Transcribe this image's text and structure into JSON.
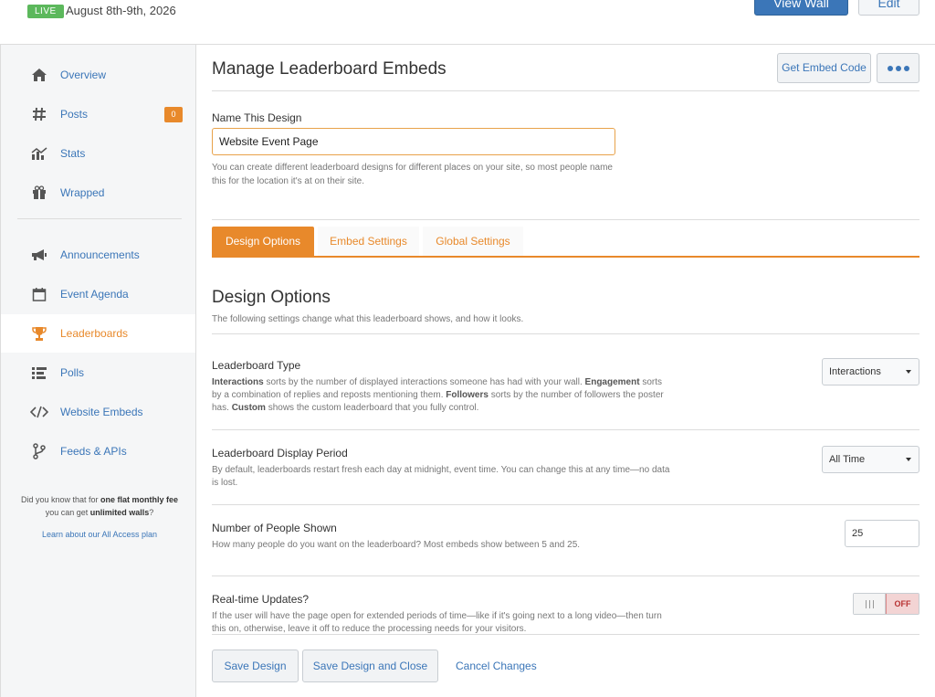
{
  "header": {
    "live_badge": "LIVE",
    "event_date": "August 8th-9th, 2026",
    "view_wall_label": "View Wall",
    "edit_label": "Edit"
  },
  "sidebar": {
    "items": [
      {
        "label": "Overview",
        "icon": "home-icon"
      },
      {
        "label": "Posts",
        "icon": "hashtag-icon",
        "badge": "0"
      },
      {
        "label": "Stats",
        "icon": "chart-icon"
      },
      {
        "label": "Wrapped",
        "icon": "gift-icon"
      },
      {
        "label": "Announcements",
        "icon": "megaphone-icon"
      },
      {
        "label": "Event Agenda",
        "icon": "calendar-icon"
      },
      {
        "label": "Leaderboards",
        "icon": "trophy-icon"
      },
      {
        "label": "Polls",
        "icon": "list-icon"
      },
      {
        "label": "Website Embeds",
        "icon": "code-icon"
      },
      {
        "label": "Feeds & APIs",
        "icon": "branch-icon"
      }
    ],
    "promo_pre": "Did you know that for ",
    "promo_bold1": "one flat monthly fee",
    "promo_mid": " you can get ",
    "promo_bold2": "unlimited walls",
    "promo_post": "?",
    "promo_link": "Learn about our All Access plan"
  },
  "main": {
    "title": "Manage Leaderboard Embeds",
    "embed_code_label": "Get Embed Code",
    "name_label": "Name This Design",
    "name_value": "Website Event Page",
    "name_help": "You can create different leaderboard designs for different places on your site, so most people name this for the location it's at on their site.",
    "tabs": [
      {
        "label": "Design Options"
      },
      {
        "label": "Embed Settings"
      },
      {
        "label": "Global Settings"
      }
    ],
    "section_title": "Design Options",
    "section_desc": "The following settings change what this leaderboard shows, and how it looks.",
    "settings": {
      "type": {
        "title": "Leaderboard Type",
        "b1": "Interactions",
        "t1": " sorts by the number of displayed interactions someone has had with your wall. ",
        "b2": "Engagement",
        "t2": " sorts by a combination of replies and reposts mentioning them. ",
        "b3": "Followers",
        "t3": " sorts by the number of followers the poster has. ",
        "b4": "Custom",
        "t4": " shows the custom leaderboard that you fully control.",
        "value": "Interactions"
      },
      "period": {
        "title": "Leaderboard Display Period",
        "desc": "By default, leaderboards restart fresh each day at midnight, event time. You can change this at any time—no data is lost.",
        "value": "All Time"
      },
      "people": {
        "title": "Number of People Shown",
        "desc": "How many people do you want on the leaderboard? Most embeds show between 5 and 25.",
        "value": "25"
      },
      "realtime": {
        "title": "Real-time Updates?",
        "desc": "If the user will have the page open for extended periods of time—like if it's going next to a long video—then turn this on, otherwise, leave it off to reduce the processing needs for your visitors.",
        "toggle_label": "OFF"
      }
    }
  },
  "footer": {
    "save_label": "Save Design",
    "save_close_label": "Save Design and Close",
    "cancel_label": "Cancel Changes"
  }
}
